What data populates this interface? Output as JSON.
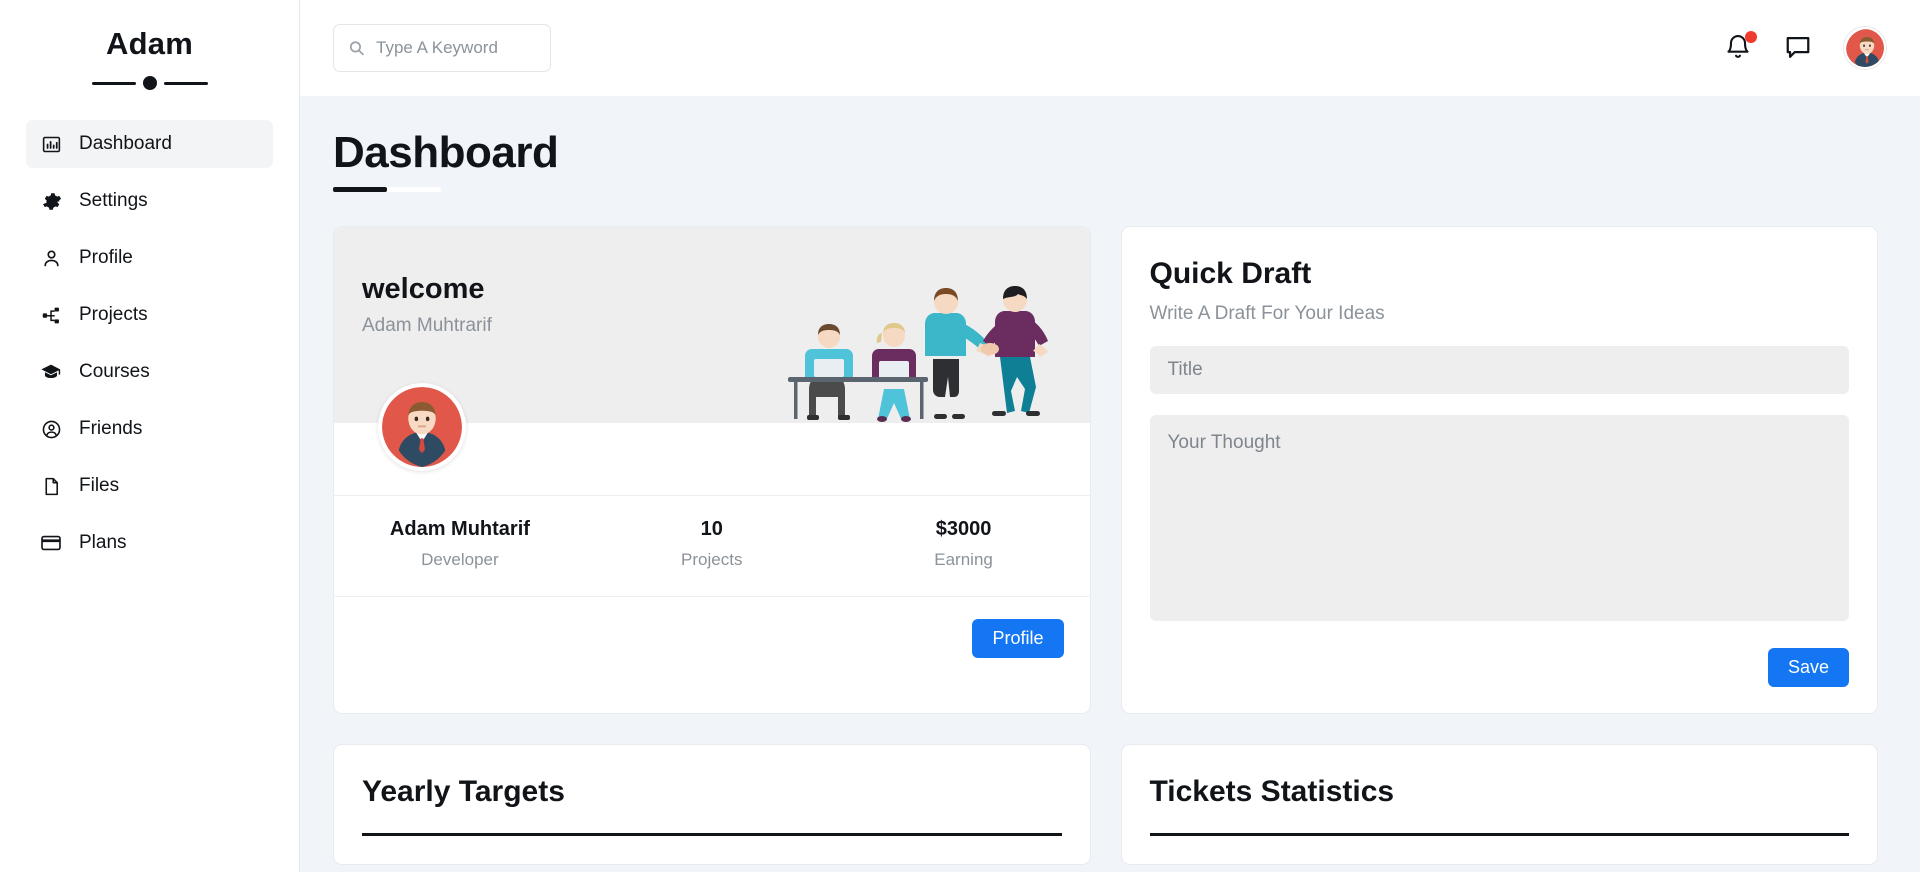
{
  "sidebar": {
    "brand": "Adam",
    "items": [
      {
        "label": "Dashboard",
        "icon": "chart-bar-icon",
        "active": true
      },
      {
        "label": "Settings",
        "icon": "gear-icon",
        "active": false
      },
      {
        "label": "Profile",
        "icon": "user-icon",
        "active": false
      },
      {
        "label": "Projects",
        "icon": "sitemap-icon",
        "active": false
      },
      {
        "label": "Courses",
        "icon": "graduation-cap-icon",
        "active": false
      },
      {
        "label": "Friends",
        "icon": "user-circle-icon",
        "active": false
      },
      {
        "label": "Files",
        "icon": "file-icon",
        "active": false
      },
      {
        "label": "Plans",
        "icon": "credit-card-icon",
        "active": false
      }
    ]
  },
  "topbar": {
    "search_placeholder": "Type A Keyword",
    "search_value": "",
    "notifications_icon": "bell-icon",
    "has_notification": true,
    "messages_icon": "chat-bubble-icon",
    "avatar_icon": "avatar"
  },
  "page": {
    "title": "Dashboard"
  },
  "welcome": {
    "title": "welcome",
    "subtitle": "Adam Muhtrarif",
    "stats": [
      {
        "value": "Adam Muhtarif",
        "label": "Developer"
      },
      {
        "value": "10",
        "label": "Projects"
      },
      {
        "value": "$3000",
        "label": "Earning"
      }
    ],
    "button_label": "Profile"
  },
  "quick_draft": {
    "title": "Quick Draft",
    "subtitle": "Write A Draft For Your Ideas",
    "title_placeholder": "Title",
    "title_value": "",
    "thought_placeholder": "Your Thought",
    "thought_value": "",
    "save_label": "Save"
  },
  "yearly_targets": {
    "title": "Yearly Targets"
  },
  "tickets_statistics": {
    "title": "Tickets Statistics"
  },
  "colors": {
    "accent": "#1476f2",
    "notification": "#ef3b2d",
    "page_bg": "#f1f5f9",
    "card_bg": "#ffffff",
    "field_bg": "#eeeeee",
    "muted_text": "#8b9299"
  }
}
